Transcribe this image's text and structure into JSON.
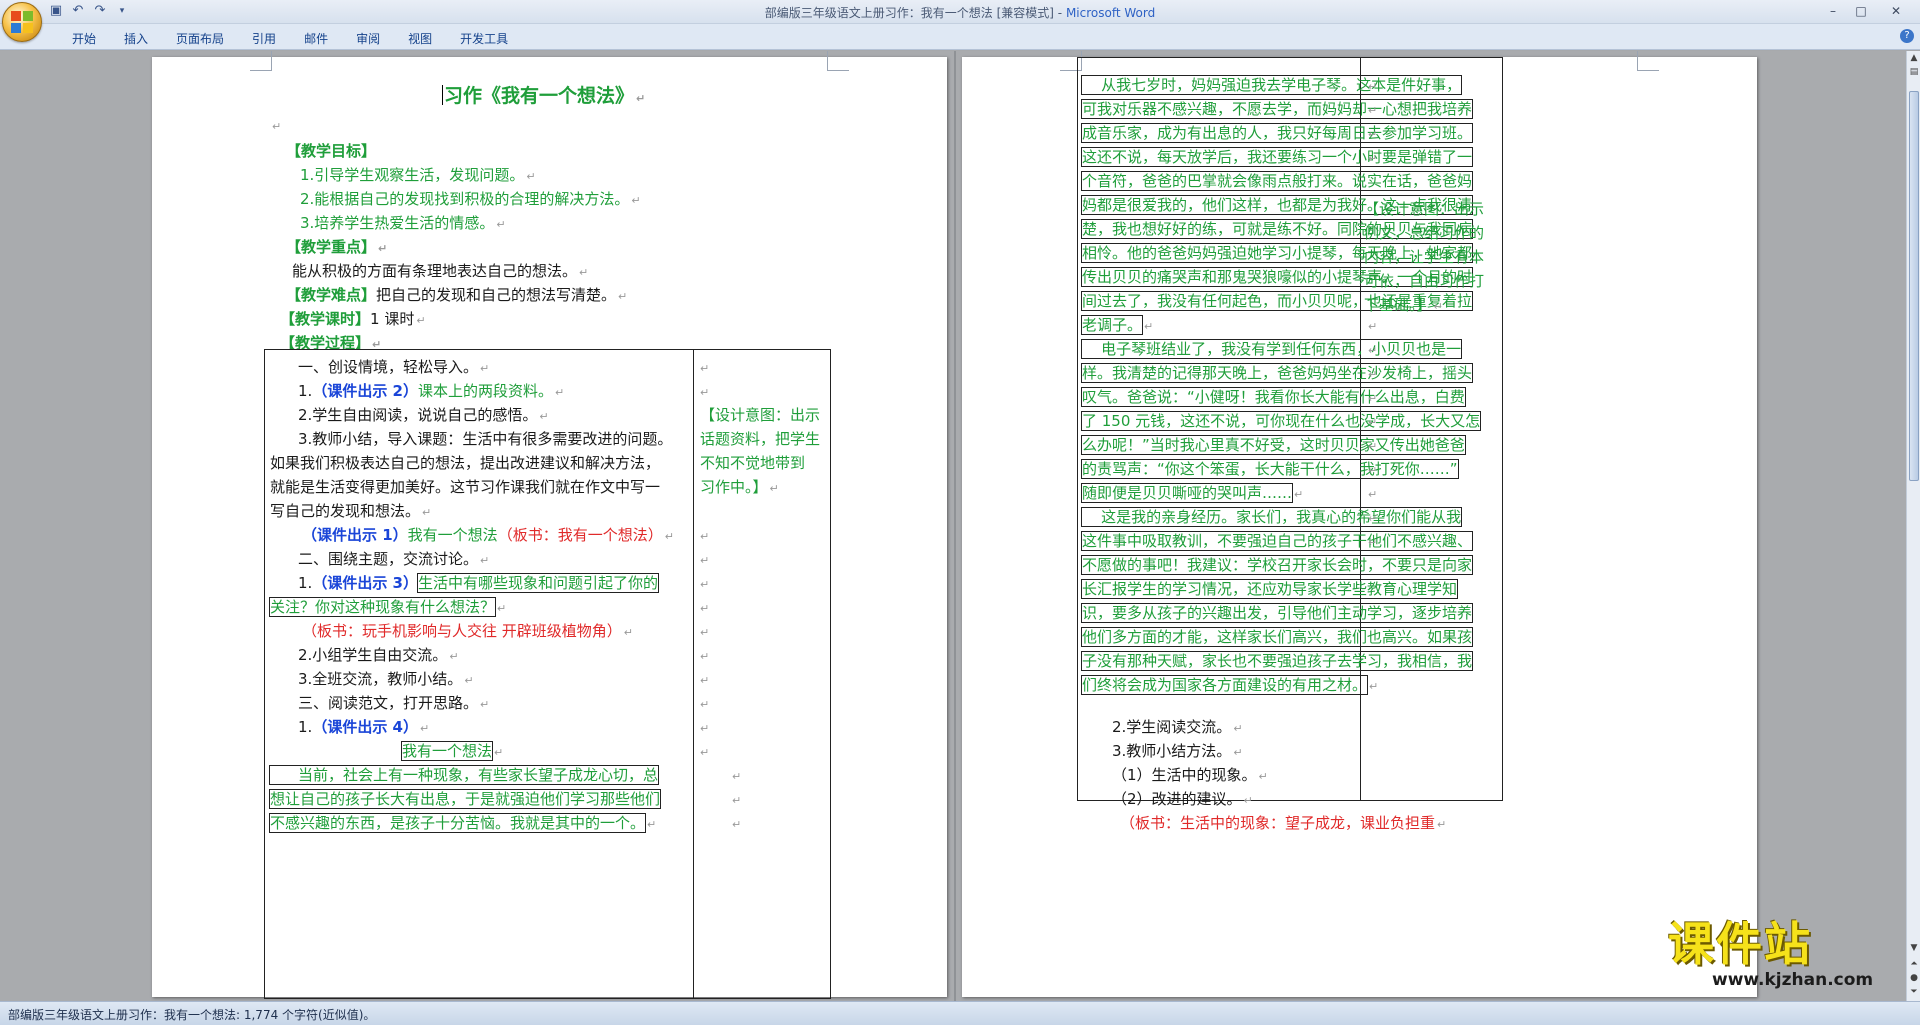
{
  "window": {
    "title": "部编版三年级语文上册习作：我有一个想法 [兼容模式]",
    "app_name": "Microsoft Word",
    "minimize": "–",
    "maximize": "□",
    "close": "✕",
    "help": "?"
  },
  "quick_access": {
    "save_icon": "save-icon",
    "undo_icon": "undo-icon",
    "redo_icon": "redo-icon",
    "customize_icon": "chevron-down-icon"
  },
  "ribbon": {
    "tabs": [
      {
        "label": "开始"
      },
      {
        "label": "插入"
      },
      {
        "label": "页面布局"
      },
      {
        "label": "引用"
      },
      {
        "label": "邮件"
      },
      {
        "label": "审阅"
      },
      {
        "label": "视图"
      },
      {
        "label": "开发工具"
      }
    ]
  },
  "left_page": {
    "title": "习作《我有一个想法》",
    "goals_heading": "【教学目标】",
    "goal1": "1.引导学生观察生活，发现问题。",
    "goal2": "2.能根据自己的发现找到积极的合理的解决方法。",
    "goal3": "3.培养学生热爱生活的情感。",
    "key_heading": "【教学重点】",
    "key_text": "能从积极的方面有条理地表达自己的想法。",
    "difficulty_heading": "【教学难点】",
    "difficulty_text": "把自己的发现和自己的想法写清楚。",
    "hours_heading": "【教学课时】",
    "hours_text": "1 课时",
    "process_heading": "【教学过程】",
    "table": {
      "s1_title": "一、创设情境，轻松导入。",
      "s1_1_num": "1.",
      "s1_1_tag": "（课件出示 2）",
      "s1_1_text": "课本上的两段资料。",
      "s1_2": "2.学生自由阅读，说说自己的感悟。",
      "s1_3_a": "3.教师小结，导入课题：生活中有很多需要改进的问题。",
      "s1_3_b": "如果我们积极表达自己的想法，提出改进建议和解决方法，",
      "s1_3_c": "就能是生活变得更加美好。这节习作课我们就在作文中写一",
      "s1_3_d": "写自己的发现和想法。",
      "c1_tag": "（课件出示 1）",
      "c1_text": "我有一个想法",
      "c1_board": "（板书：我有一个想法）",
      "s2_title": "二、围绕主题，交流讨论。",
      "s2_1_num": "1.",
      "s2_1_tag": "（课件出示 3）",
      "s2_1_text_a": "生活中有哪些现象和问题引起了你的",
      "s2_1_text_b": "关注？你对这种现象有什么想法？",
      "s2_board": "（板书：玩手机影响与人交往  开辟班级植物角）",
      "s2_2": "2.小组学生自由交流。",
      "s2_3": "3.全班交流，教师小结。",
      "s3_title": "三、阅读范文，打开思路。",
      "s3_1_num": "1.",
      "s3_1_tag": "（课件出示 4）",
      "essay_title": "我有一个想法",
      "essay_a": "当前，社会上有一种现象，有些家长望子成龙心切，总",
      "essay_b": "想让自己的孩子长大有出息，于是就强迫他们学习那些他们",
      "essay_c": "不感兴趣的东西，是孩子十分苦恼。我就是其中的一个。",
      "design_a": "【设计意图：出示",
      "design_b": "话题资料，把学生",
      "design_c": "不知不觉地带到",
      "design_d": "习作中。】"
    }
  },
  "right_page": {
    "essay": [
      "    从我七岁时，妈妈强迫我去学电子琴。这本是件好事，",
      "可我对乐器不感兴趣，不愿去学，而妈妈却一心想把我培养",
      "成音乐家，成为有出息的人，我只好每周日去参加学习班。",
      "这还不说，每天放学后，我还要练习一个小时要是弹错了一",
      "个音符，爸爸的巴掌就会像雨点般打来。说实在话，爸爸妈",
      "妈都是很爱我的，他们这样，也都是为我好。这一点我很清",
      "楚，我也想好好的练，可就是练不好。同院的贝贝与我同病",
      "相怜。他的爸爸妈妈强迫她学习小提琴，每天晚上，她家都",
      "传出贝贝的痛哭声和那鬼哭狼嚎似的小提琴声。一个月的时",
      "间过去了，我没有任何起色，而小贝贝呢，也还是重复着拉",
      "老调子。",
      "    电子琴班结业了，我没有学到任何东西，小贝贝也是一",
      "样。我清楚的记得那天晚上，爸爸妈妈坐在沙发椅上，摇头",
      "叹气。爸爸说：“小健呀！我看你长大能有什么出息，白费",
      "了 150 元钱，这还不说，可你现在什么也没学成，长大又怎",
      "么办呢！”当时我心里真不好受，这时贝贝家又传出她爸爸",
      "的责骂声：“你这个笨蛋，长大能干什么，我打死你……”",
      "随即便是贝贝嘶哑的哭叫声……",
      "    这是我的亲身经历。家长们，我真心的希望你们能从我",
      "这件事中吸取教训，不要强迫自己的孩子干他们不感兴趣、",
      "不愿做的事吧！我建议：学校召开家长会时，不要只是向家",
      "长汇报学生的学习情况，还应劝导家长学些教育心理学知",
      "识，要多从孩子的兴趣出发，引导他们主动学习，逐步培养",
      "他们多方面的才能，这样家长们高兴，我们也高兴。如果孩",
      "子没有那种天赋，家长也不要强迫孩子去学习，我相信，我",
      "们终将会成为国家各方面建设的有用之材。"
    ],
    "design_a": "【设计意图：出示",
    "design_b": "例文，总结习作的",
    "design_c": "内容，让学生有本",
    "design_d": "可依，自由习作打",
    "design_e": "下基础。】",
    "s2": "2.学生阅读交流。",
    "s3": "3.教师小结方法。",
    "s3_1": "（1）生活中的现象。",
    "s3_2": "（2）改进的建议。",
    "board": "（板书：生活中的现象：望子成龙，课业负担重"
  },
  "status": {
    "text": "部编版三年级语文上册习作：我有一个想法: 1,774 个字符(近似值)。"
  },
  "watermark": {
    "main": "课件站",
    "url": "www.kjzhan.com"
  },
  "paragraph_mark": "↵",
  "colors": {
    "green": "#1f9e3a",
    "blue": "#1a45d8",
    "red": "#e02a2a"
  }
}
